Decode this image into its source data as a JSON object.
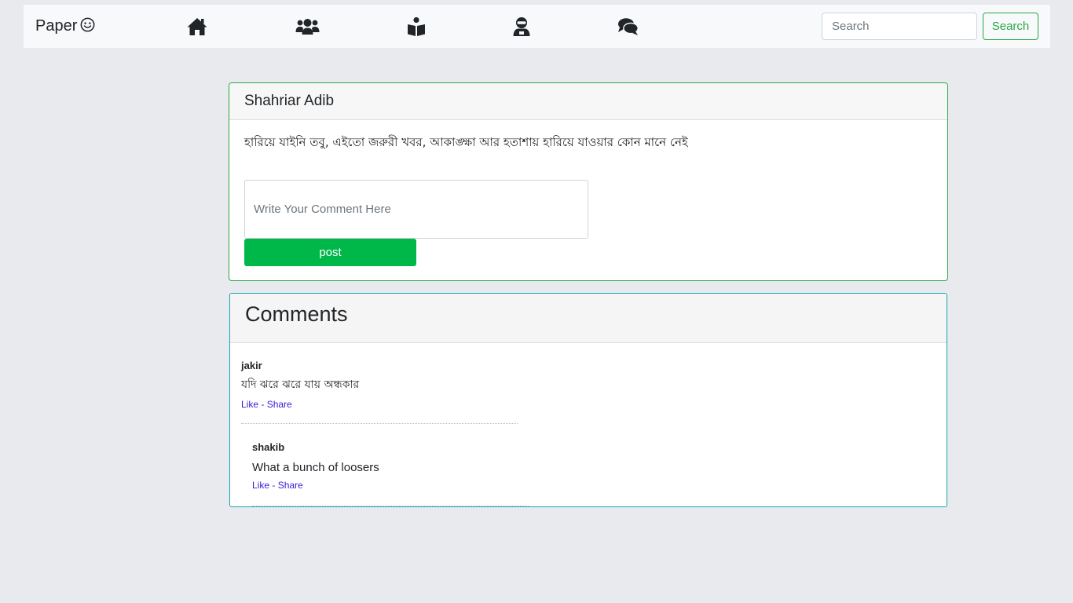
{
  "navbar": {
    "brand": "Paper",
    "brand_icon": "smiley-icon",
    "icons": [
      "home-icon",
      "users-icon",
      "reader-icon",
      "user-ninja-icon",
      "comments-icon"
    ],
    "search": {
      "placeholder": "Search",
      "button_label": "Search"
    }
  },
  "post": {
    "author": "Shahriar Adib",
    "text": "হারিয়ে যাইনি তবু, এইতো জরুরী খবর, আকাঙ্ক্ষা আর হতাশায় হারিয়ে যাওয়ার কোন মানে নেই",
    "comment_placeholder": "Write Your Comment Here",
    "post_button_label": "post"
  },
  "comments": {
    "title": "Comments",
    "items": [
      {
        "author": "jakir",
        "text": "যদি ঝরে ঝরে যায় অন্ধকার",
        "like_label": "Like",
        "separator": " - ",
        "share_label": "Share"
      },
      {
        "author": "shakib",
        "text": "What a bunch of loosers",
        "like_label": "Like",
        "separator": " - ",
        "share_label": "Share"
      }
    ]
  },
  "colors": {
    "page_bg": "#e9eaee",
    "navbar_bg": "#f8f9fa",
    "success": "#28a745",
    "post_button": "#00b84a",
    "info_border": "#17a2b8",
    "link": "#3d18d6"
  }
}
